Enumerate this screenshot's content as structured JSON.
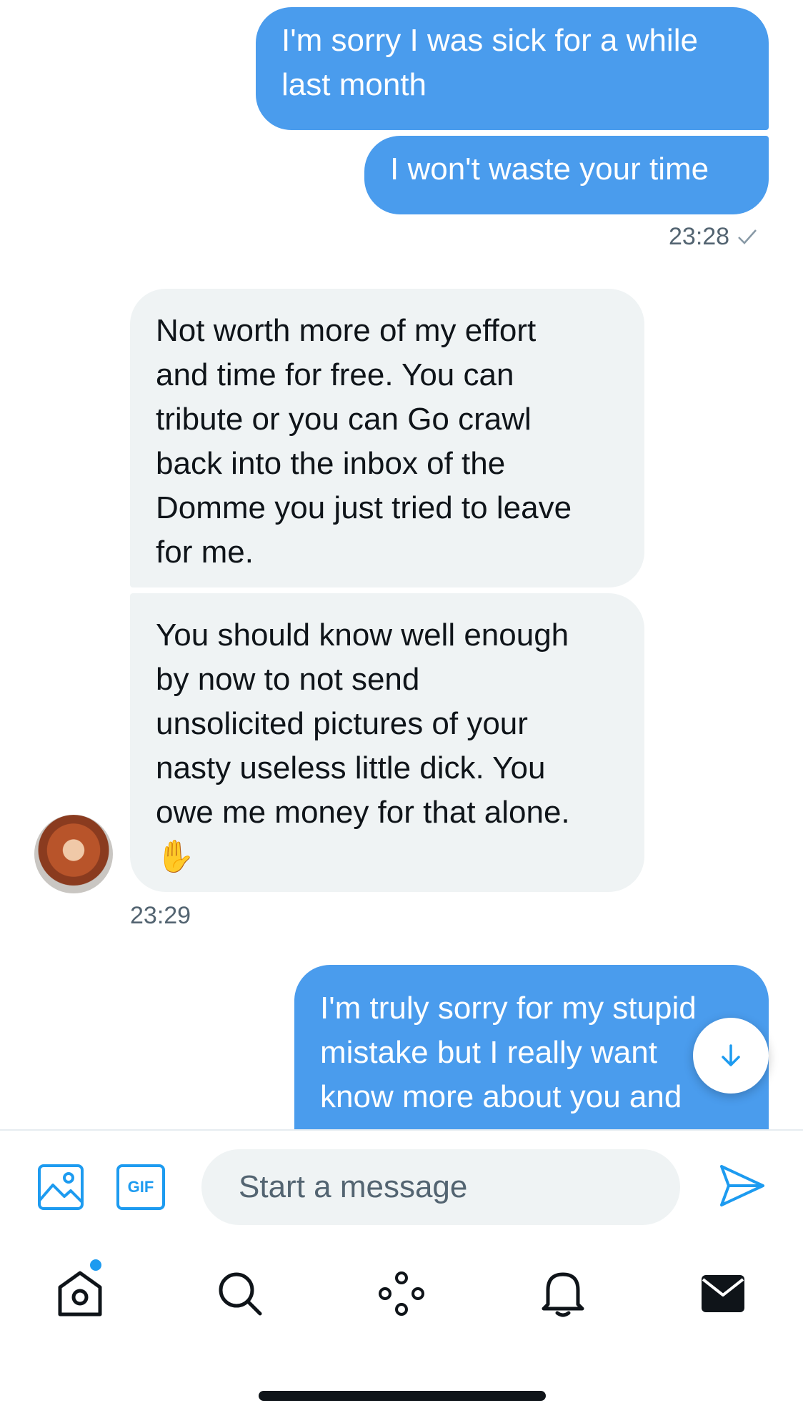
{
  "messages": [
    {
      "dir": "out",
      "text": "I'm sorry I was sick for a while\nlast month"
    },
    {
      "dir": "out",
      "text": "I won't waste your time"
    },
    {
      "dir": "in",
      "text": "Not worth more of my effort\nand time for free. You can\ntribute or you can Go crawl\nback into the inbox of the\nDomme you just tried to leave\nfor me."
    },
    {
      "dir": "in",
      "text": "You should know well enough\nby now to not send\nunsolicited pictures of your\nnasty useless little dick. You\nowe me money for that alone.\n✋"
    },
    {
      "dir": "out",
      "text": "I'm truly sorry for my stupid\nmistake but I really want\nknow more about you and"
    }
  ],
  "timestamps": {
    "first": "23:28",
    "second": "23:29"
  },
  "read_receipt_icon": "checkmark-icon",
  "composer": {
    "placeholder": "Start a message",
    "gif_label": "GIF"
  },
  "tabs": [
    "home",
    "search",
    "spaces",
    "notifications",
    "messages"
  ],
  "colors": {
    "accent": "#1d9bf0",
    "outgoing_bubble": "#4a9ced",
    "incoming_bubble": "#eff3f4"
  }
}
